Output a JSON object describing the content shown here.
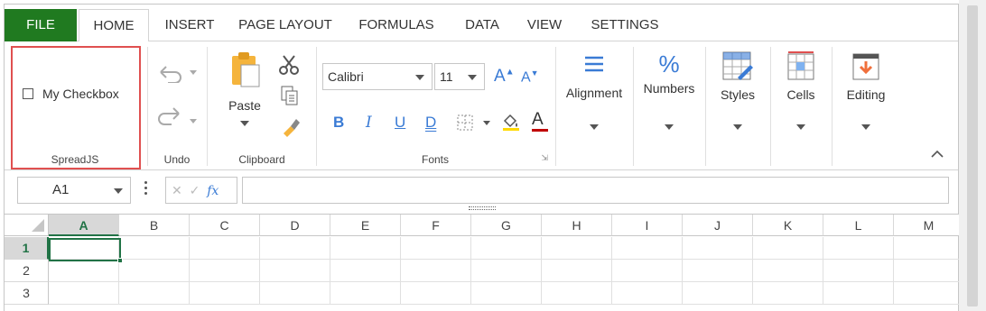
{
  "tabs": {
    "file": "FILE",
    "items": [
      "HOME",
      "INSERT",
      "PAGE LAYOUT",
      "FORMULAS",
      "DATA",
      "VIEW",
      "SETTINGS"
    ]
  },
  "ribbon": {
    "spreadjs": {
      "checkbox_label": "My Checkbox",
      "group_label": "SpreadJS"
    },
    "undo": {
      "group_label": "Undo"
    },
    "clipboard": {
      "paste_label": "Paste",
      "group_label": "Clipboard"
    },
    "fonts": {
      "font_family": "Calibri",
      "font_size": "11",
      "bold": "B",
      "italic": "I",
      "underline": "U",
      "double_underline": "D",
      "font_color_letter": "A",
      "grow": "A",
      "shrink": "A",
      "group_label": "Fonts"
    },
    "alignment": "Alignment",
    "numbers": "Numbers",
    "styles": "Styles",
    "cells": "Cells",
    "editing": "Editing"
  },
  "formula_bar": {
    "name_box": "A1",
    "fx": "fx",
    "formula": ""
  },
  "grid": {
    "columns": [
      "A",
      "B",
      "C",
      "D",
      "E",
      "F",
      "G",
      "H",
      "I",
      "J",
      "K",
      "L",
      "M"
    ],
    "rows": [
      "1",
      "2",
      "3"
    ],
    "active_cell": "A1"
  },
  "colors": {
    "file_tab": "#207a20",
    "selection": "#217346",
    "highlight_box": "#e05050",
    "format_blue": "#3a7bd5"
  }
}
